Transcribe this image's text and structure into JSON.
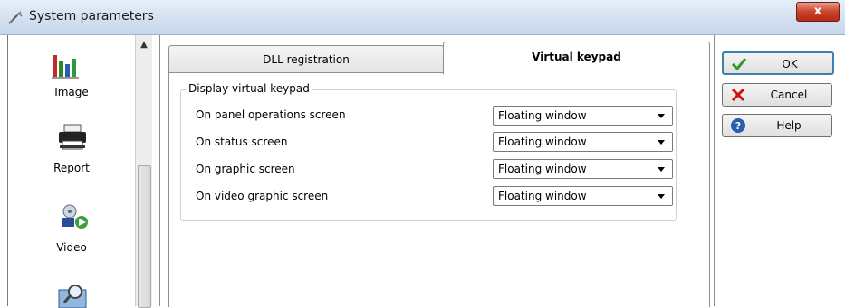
{
  "window": {
    "title": "System parameters",
    "close_label": "x"
  },
  "sidebar": {
    "items": [
      {
        "label": "Image",
        "icon": "bar-chart-icon"
      },
      {
        "label": "Report",
        "icon": "printer-icon"
      },
      {
        "label": "Video",
        "icon": "video-icon"
      },
      {
        "label": "",
        "icon": "search-computer-icon"
      }
    ],
    "scroll_up": "▲"
  },
  "tabs": [
    {
      "label": "DLL registration",
      "active": false
    },
    {
      "label": "Virtual keypad",
      "active": true
    }
  ],
  "group": {
    "title": "Display virtual keypad",
    "rows": [
      {
        "label": "On panel operations screen",
        "value": "Floating window"
      },
      {
        "label": "On status screen",
        "value": "Floating window"
      },
      {
        "label": "On graphic screen",
        "value": "Floating window"
      },
      {
        "label": "On video graphic screen",
        "value": "Floating window"
      }
    ]
  },
  "buttons": {
    "ok": "OK",
    "cancel": "Cancel",
    "help": "Help"
  },
  "colors": {
    "ok_check": "#2e9a2e",
    "cancel_x": "#d01010",
    "help_circle": "#2a5db0"
  }
}
